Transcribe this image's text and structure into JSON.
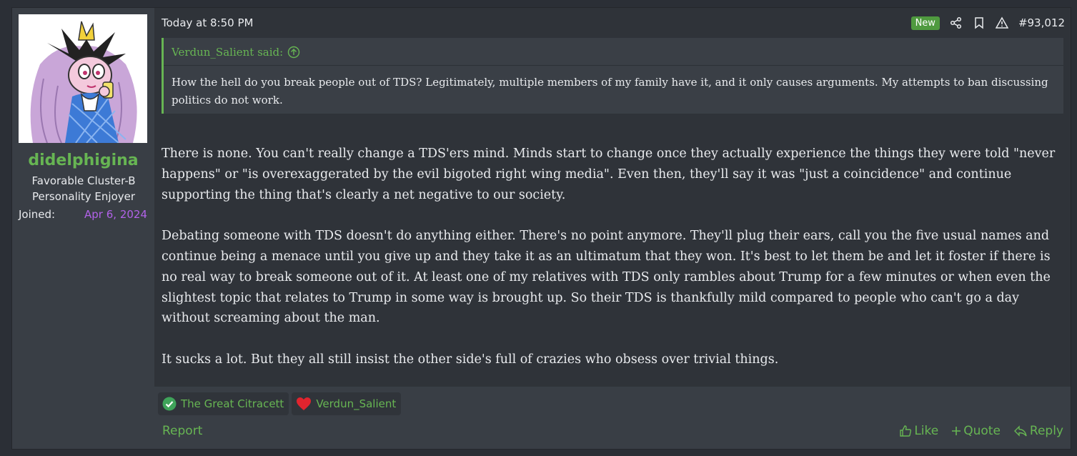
{
  "user": {
    "name": "didelphigina",
    "title": "Favorable Cluster-B Personality Enjoyer",
    "joined_label": "Joined:",
    "joined_date": "Apr 6, 2024"
  },
  "post": {
    "time": "Today at 8:50 PM",
    "badge": "New",
    "number": "#93,012",
    "quote": {
      "author": "Verdun_Salient said:",
      "text": "How the hell do you break people out of TDS? Legitimately, multiple members of my family have it, and it only causes arguments. My attempts to ban discussing politics do not work."
    },
    "paragraphs": [
      "There is none. You can't really change a TDS'ers mind. Minds start to change once they actually experience the things they were told \"never happens\" or \"is overexaggerated by the evil bigoted right wing media\". Even then, they'll say it was \"just a coincidence\" and continue supporting the thing that's clearly a net negative to our society.",
      "Debating someone with TDS doesn't do anything either. There's no point anymore. They'll plug their ears, call you the five usual names and continue being a menace until you give up and they take it as an ultimatum that they won. It's best to let them be and let it foster if there is no real way to break someone out of it. At least one of my relatives with TDS only rambles about Trump for a few minutes or when even the slightest topic that relates to Trump in some way is brought up. So their TDS is thankfully mild compared to people who can't go a day without screaming about the man.",
      "It sucks a lot. But they all still insist the other side's full of crazies who obsess over trivial things."
    ]
  },
  "reactions": [
    {
      "icon": "check-circle-icon",
      "user": "The Great Citracett"
    },
    {
      "icon": "heart-icon",
      "user": "Verdun_Salient"
    }
  ],
  "footer": {
    "report": "Report",
    "like": "Like",
    "quote": "Quote",
    "reply": "Reply"
  },
  "colors": {
    "accent": "#67b553",
    "joined_date": "#b162e8",
    "badge": "#4f9a3f"
  }
}
